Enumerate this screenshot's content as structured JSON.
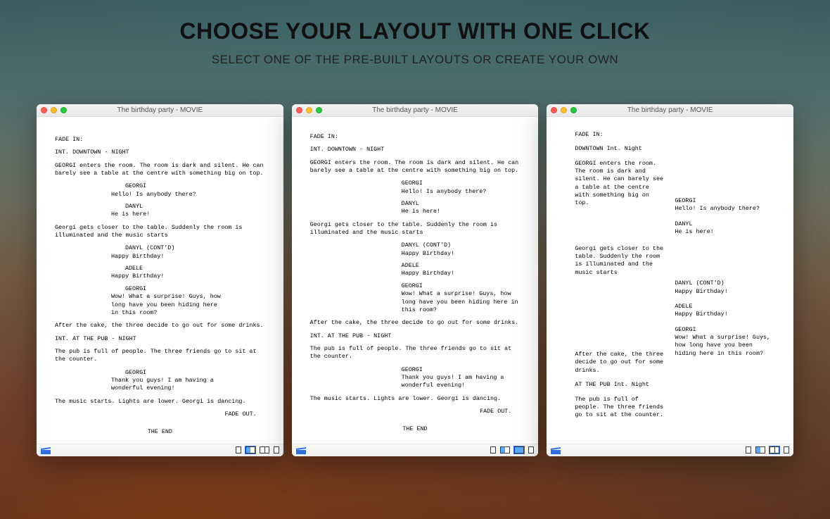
{
  "headline": "CHOOSE YOUR LAYOUT WITH ONE CLICK",
  "subhead": "SELECT ONE OF THE PRE-BUILT LAYOUTS OR CREATE YOUR OWN",
  "window_title": "The birthday party - MOVIE",
  "screenplay": {
    "fade_in": "FADE IN:",
    "scene1_slug": "INT. DOWNTOWN - NIGHT",
    "scene1_slug_alt": "DOWNTOWN Int. Night",
    "action1": "GEORGI enters the room. The room is dark and silent. He can barely see a table at the centre with something big on top.",
    "d1": {
      "name": "GEORGI",
      "text": "Hello! Is anybody there?"
    },
    "d2": {
      "name": "DANYL",
      "text": "He is here!"
    },
    "action2": "Georgi gets closer to the table. Suddenly the room is illuminated and the music starts",
    "d3": {
      "name": "DANYL (CONT'D)",
      "text": "Happy Birthday!"
    },
    "d4": {
      "name": "ADELE",
      "text": "Happy Birthday!"
    },
    "d5": {
      "name": "GEORGI",
      "text": "Wow! What a surprise! Guys, how long have you been hiding here in this room?"
    },
    "action3": "After the cake, the three decide to go out for some drinks.",
    "scene2_slug": "INT. AT THE PUB - NIGHT",
    "scene2_slug_alt": "AT THE PUB Int. Night",
    "action4": "The pub is full of people. The three friends go to sit at the counter.",
    "d6": {
      "name": "GEORGI",
      "text": "Thank you guys! I am having a wonderful evening!"
    },
    "action5": "The music starts. Lights are lower. Georgi is dancing.",
    "fade_out": "FADE OUT.",
    "the_end": "THE END"
  }
}
